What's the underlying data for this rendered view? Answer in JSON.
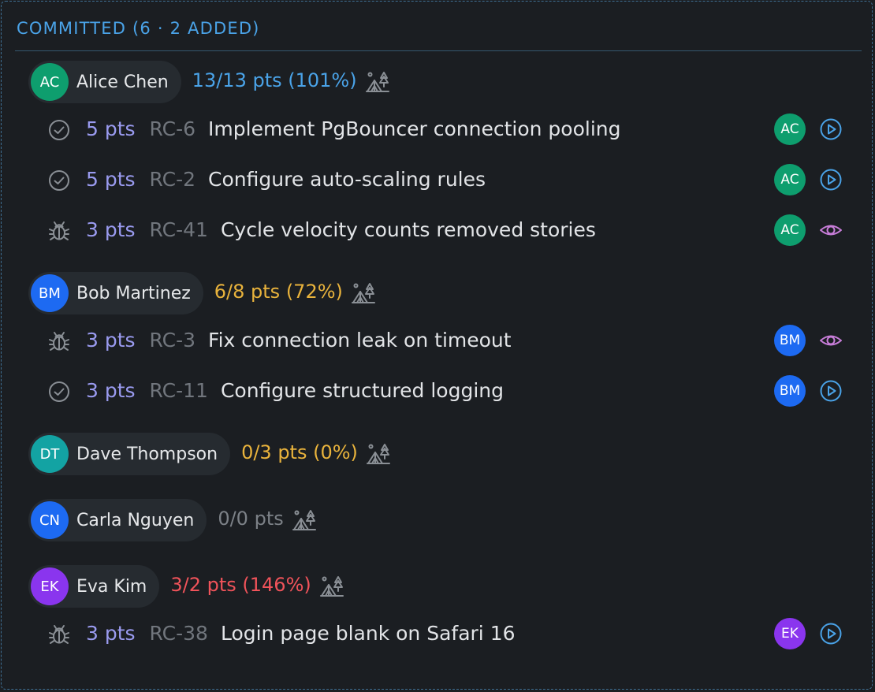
{
  "section": {
    "title": "COMMITTED (6 · 2 ADDED)"
  },
  "colors": {
    "accent": "#4aa3e8",
    "points": "#9a9bf0",
    "over": "#f0535a",
    "warn": "#e9b33c",
    "neutral": "#7c8187"
  },
  "people": [
    {
      "initials": "AC",
      "name": "Alice Chen",
      "avatar_color": "#0e9e6e",
      "summary": "13/13 pts (101%)",
      "summary_color": "#4aa3e8",
      "tasks": [
        {
          "status_icon": "check-circle-icon",
          "pts": "5 pts",
          "id": "RC-6",
          "title": "Implement PgBouncer connection pooling",
          "action_icon": "play-circle-icon"
        },
        {
          "status_icon": "check-circle-icon",
          "pts": "5 pts",
          "id": "RC-2",
          "title": "Configure auto-scaling rules",
          "action_icon": "play-circle-icon"
        },
        {
          "status_icon": "bug-icon",
          "pts": "3 pts",
          "id": "RC-41",
          "title": "Cycle velocity counts removed stories",
          "action_icon": "eye-icon"
        }
      ]
    },
    {
      "initials": "BM",
      "name": "Bob Martinez",
      "avatar_color": "#1d6af2",
      "summary": "6/8 pts (72%)",
      "summary_color": "#e9b33c",
      "tasks": [
        {
          "status_icon": "bug-icon",
          "pts": "3 pts",
          "id": "RC-3",
          "title": "Fix connection leak on timeout",
          "action_icon": "eye-icon"
        },
        {
          "status_icon": "check-circle-icon",
          "pts": "3 pts",
          "id": "RC-11",
          "title": "Configure structured logging",
          "action_icon": "play-circle-icon"
        }
      ]
    },
    {
      "initials": "DT",
      "name": "Dave Thompson",
      "avatar_color": "#13a3a3",
      "summary": "0/3 pts (0%)",
      "summary_color": "#e9b33c",
      "tasks": []
    },
    {
      "initials": "CN",
      "name": "Carla Nguyen",
      "avatar_color": "#1d6af2",
      "summary": "0/0 pts",
      "summary_color": "#7c8187",
      "tasks": []
    },
    {
      "initials": "EK",
      "name": "Eva Kim",
      "avatar_color": "#8a35ee",
      "summary": "3/2 pts (146%)",
      "summary_color": "#f0535a",
      "tasks": [
        {
          "status_icon": "bug-icon",
          "pts": "3 pts",
          "id": "RC-38",
          "title": "Login page blank on Safari 16",
          "action_icon": "play-circle-icon"
        }
      ]
    }
  ]
}
